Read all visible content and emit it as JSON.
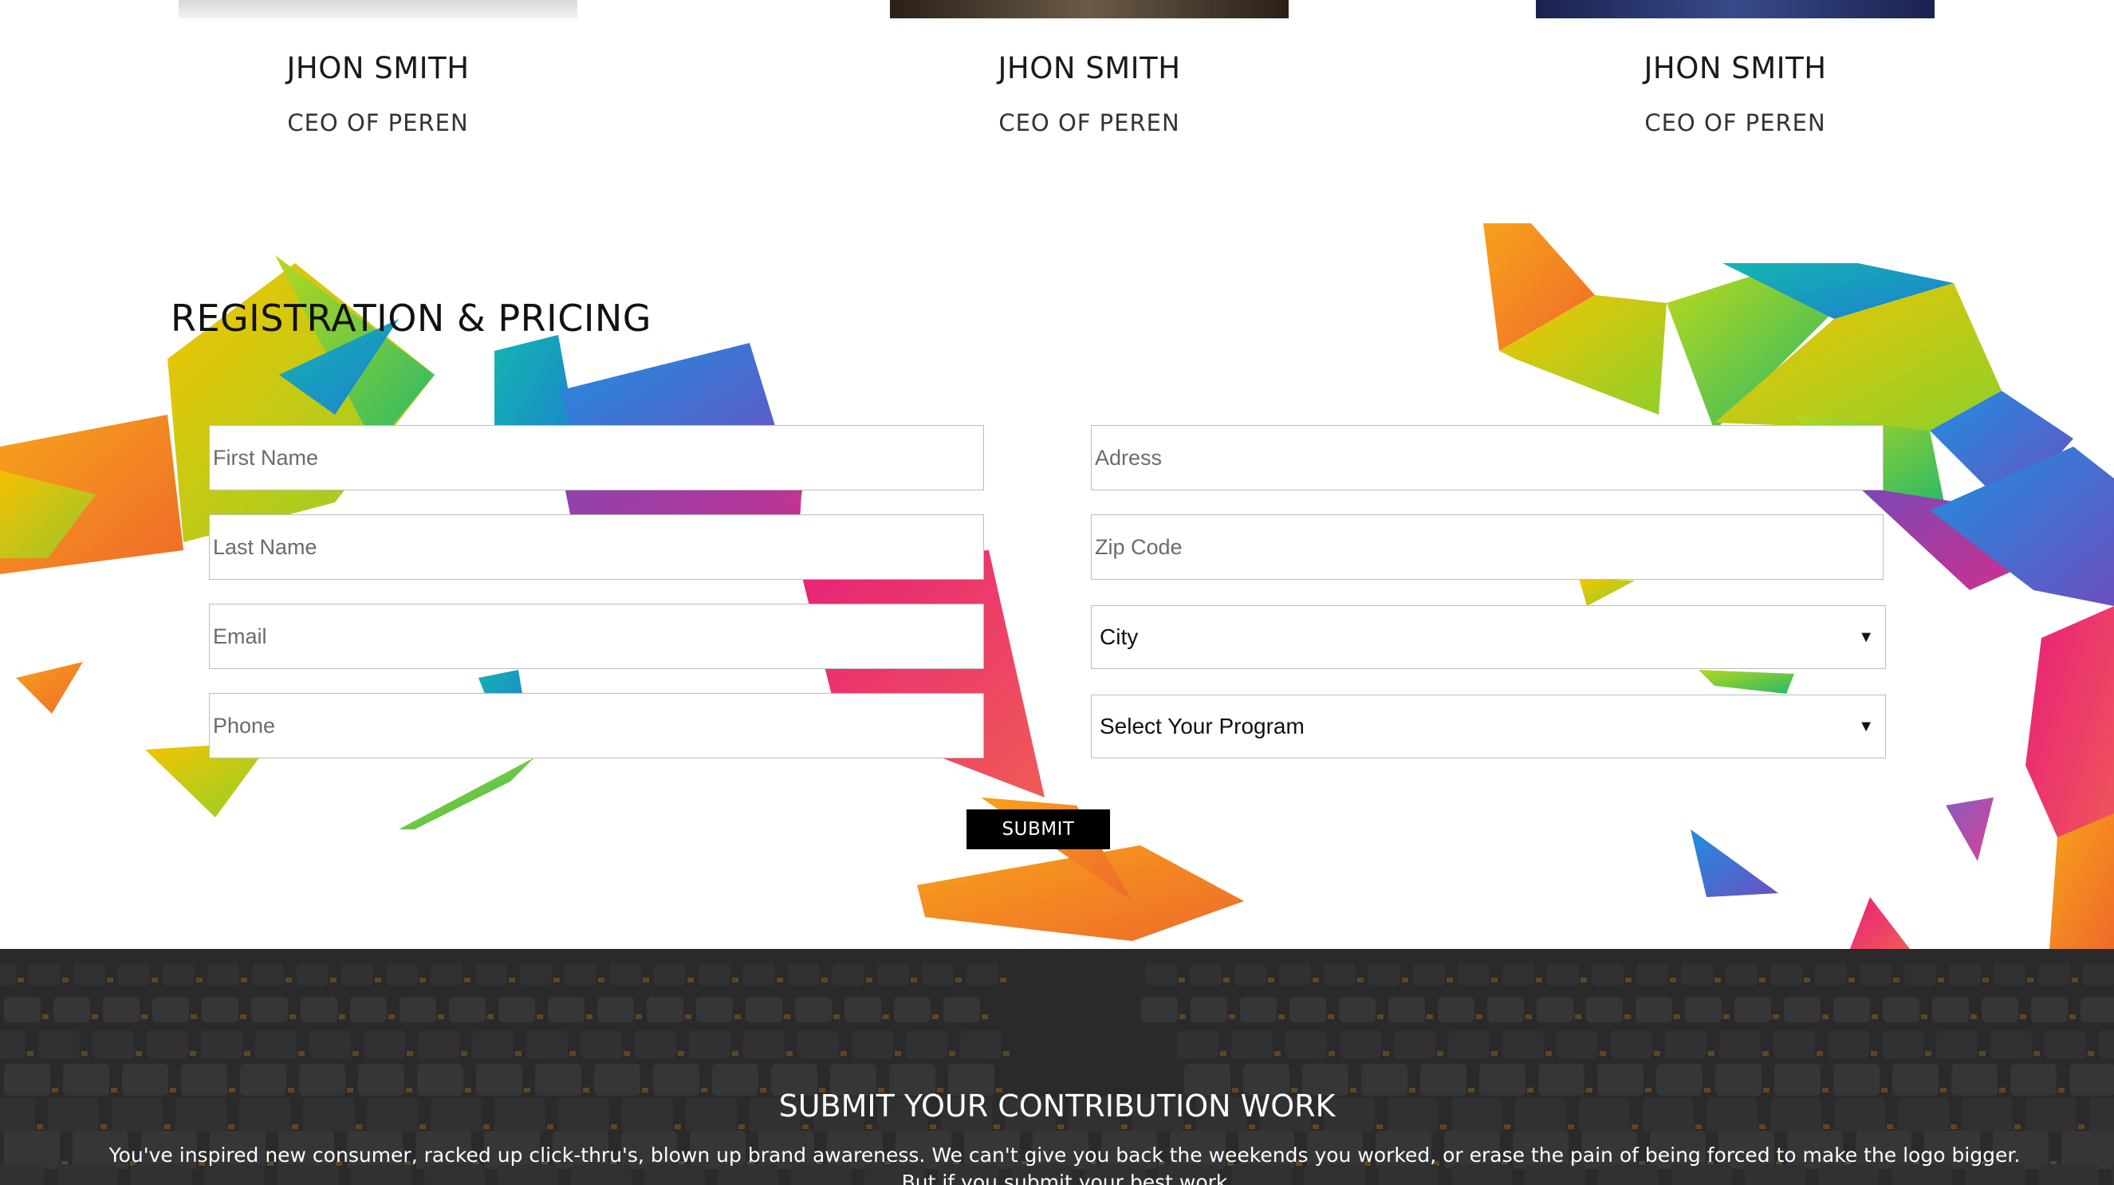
{
  "speakers": [
    {
      "name": "JHON SMITH",
      "role": "CEO OF PEREN"
    },
    {
      "name": "JHON SMITH",
      "role": "CEO OF PEREN"
    },
    {
      "name": "JHON SMITH",
      "role": "CEO OF PEREN"
    }
  ],
  "registration": {
    "title": "REGISTRATION & PRICING",
    "fields": {
      "first_name": "First Name",
      "last_name": "Last Name",
      "email": "Email",
      "phone": "Phone",
      "address": "Adress",
      "zip": "Zip Code"
    },
    "selects": {
      "city": "City",
      "program": "Select Your Program"
    },
    "submit_label": "SUBMIT"
  },
  "contribution": {
    "title": "SUBMIT YOUR CONTRIBUTION WORK",
    "text": "You've inspired new consumer, racked up click-thru's, blown up brand awareness. We can't give you back the weekends you worked, or erase the pain of being forced to make the logo bigger. But if you submit your best work"
  },
  "icons": {
    "select_caret": "caret-down-icon"
  },
  "colors": {
    "submit_bg": "#000000",
    "banner_overlay": "#2b2b2d"
  }
}
